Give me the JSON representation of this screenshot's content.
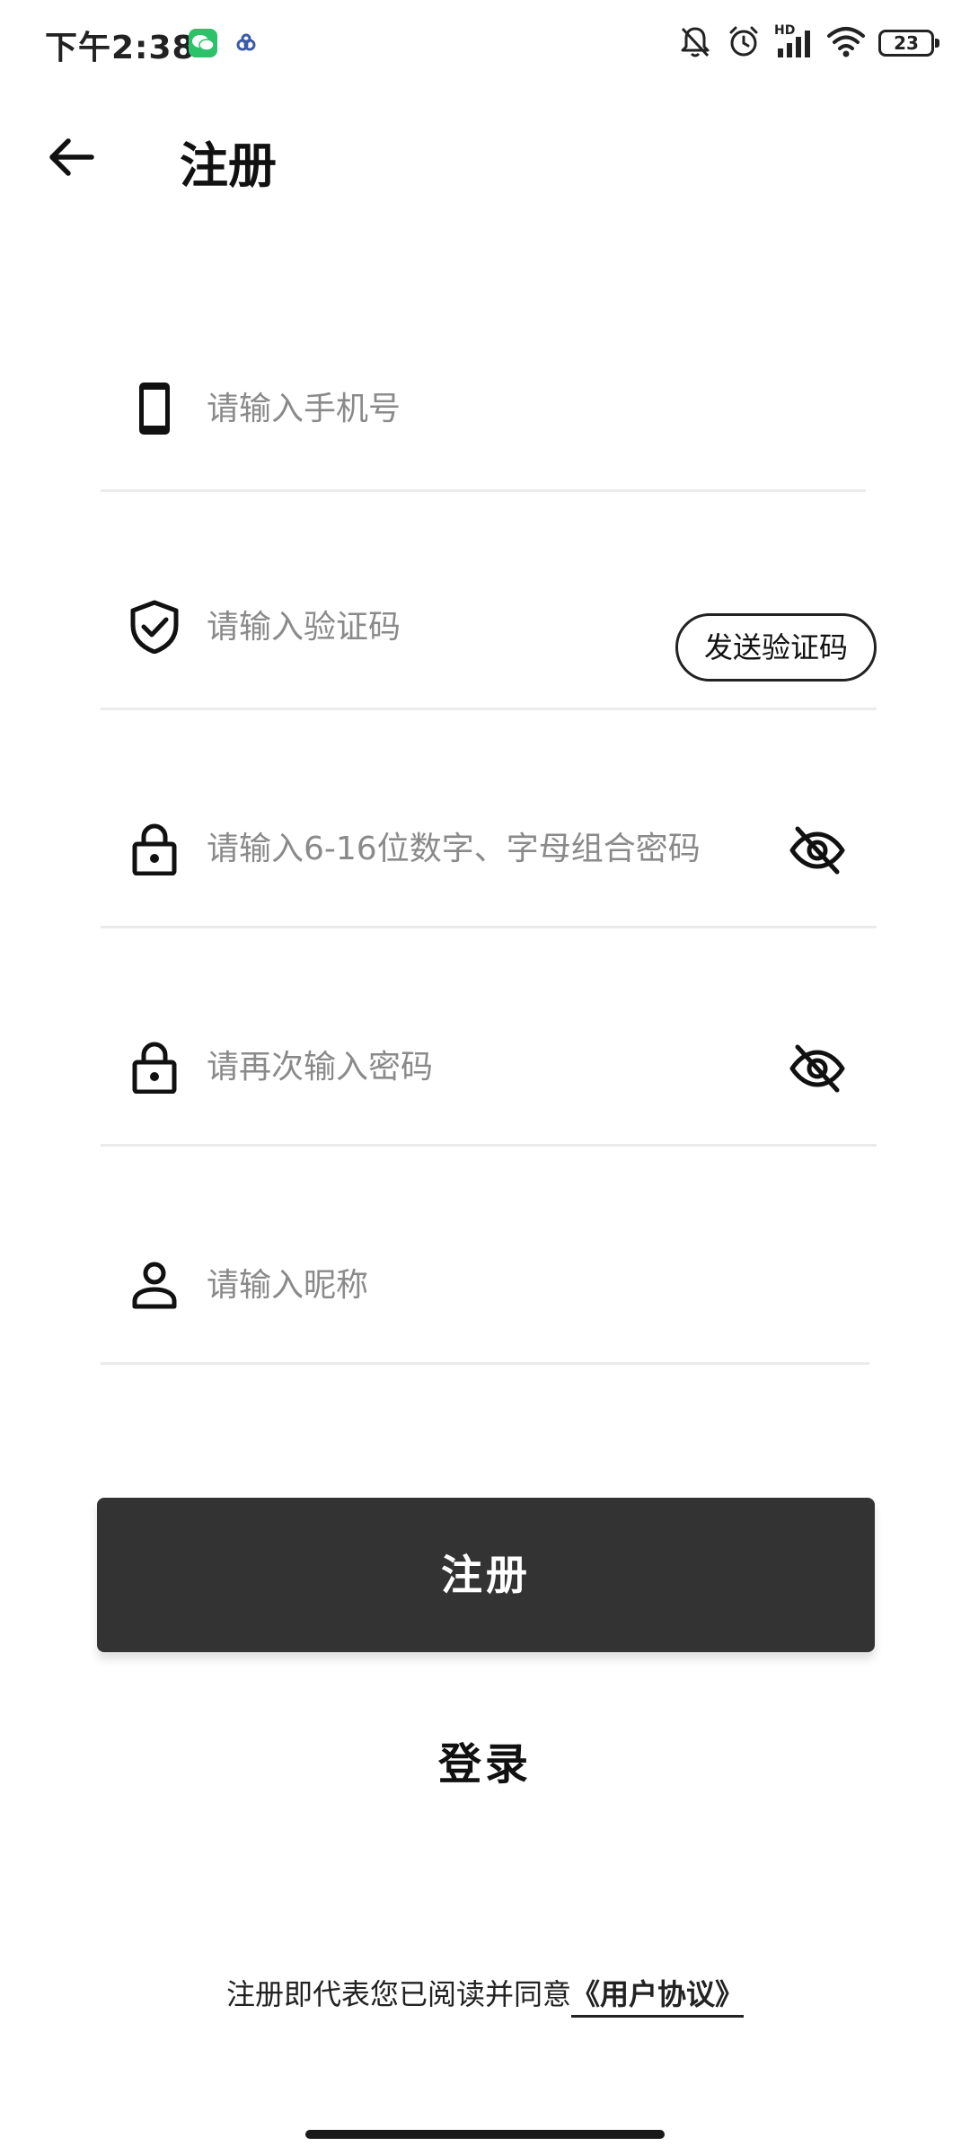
{
  "status_bar": {
    "time": "下午2:38",
    "network_label": "HD",
    "battery_level": "23"
  },
  "header": {
    "title": "注册"
  },
  "form": {
    "phone": {
      "placeholder": "请输入手机号",
      "value": ""
    },
    "code": {
      "placeholder": "请输入验证码",
      "value": "",
      "send_label": "发送验证码"
    },
    "password": {
      "placeholder": "请输入6-16位数字、字母组合密码",
      "value": ""
    },
    "confirm_password": {
      "placeholder": "请再次输入密码",
      "value": ""
    },
    "nickname": {
      "placeholder": "请输入昵称",
      "value": ""
    }
  },
  "actions": {
    "register_label": "注册",
    "login_label": "登录"
  },
  "footer": {
    "agreement_text": "注册即代表您已阅读并同意",
    "agreement_link": "《用户协议》"
  },
  "icons": {
    "back": "arrow-left-icon",
    "phone": "smartphone-icon",
    "code": "shield-check-icon",
    "password": "lock-icon",
    "nickname": "person-icon",
    "visibility": "eye-off-icon"
  },
  "colors": {
    "primary_button": "#333333",
    "divider": "#ebebeb",
    "placeholder": "#8a8a8a",
    "wechat_green": "#2bc26a"
  }
}
